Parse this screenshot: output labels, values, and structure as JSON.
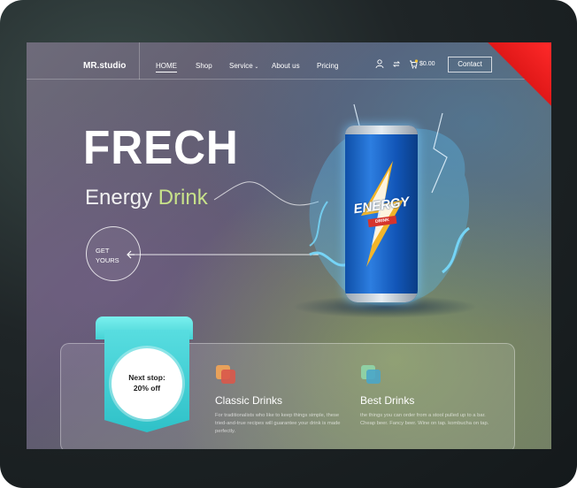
{
  "brand": {
    "logo": "MR.studio"
  },
  "nav": {
    "links": [
      {
        "label": "HOME",
        "active": true
      },
      {
        "label": "Shop",
        "active": false
      },
      {
        "label": "Service",
        "active": false
      },
      {
        "label": "About us",
        "active": false
      },
      {
        "label": "Pricing",
        "active": false
      }
    ],
    "cart_total": "$0.00",
    "contact_label": "Contact"
  },
  "hero": {
    "title": "FRECH",
    "subtitle_main": "Energy",
    "subtitle_accent": "Drink",
    "cta_line1": "GET",
    "cta_line2": "YOURS"
  },
  "product": {
    "can_brand": "ENERGY",
    "can_label": "DRINK"
  },
  "promo": {
    "line1": "Next stop:",
    "line2": "20% off"
  },
  "features": [
    {
      "title": "Classic Drinks",
      "description": "For traditionalists who like to keep things simple, these tried-and-true recipes will guarantee your drink is made perfectly."
    },
    {
      "title": "Best Drinks",
      "description": "the things you can order from a stool pulled up to a bar. Cheap beer. Fancy beer. Wine on tap. kombucha on tap."
    }
  ],
  "colors": {
    "accent_green": "#c8e28a",
    "ribbon_teal": "#46d3d6",
    "corner_red": "#e01818"
  }
}
